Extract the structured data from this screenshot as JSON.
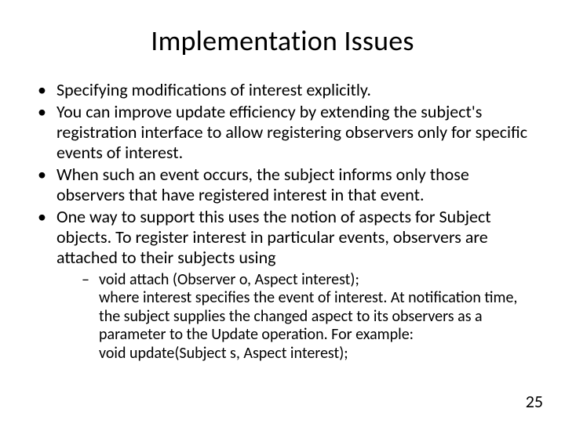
{
  "title": "Implementation Issues",
  "bullets": [
    {
      "text": "Specifying modifications of interest explicitly."
    },
    {
      "text": "You can improve update efficiency by extending the subject's registration interface to allow registering observers only for specific events of interest."
    },
    {
      "text": "When such an event occurs, the subject informs only those observers that have registered interest in that event."
    },
    {
      "text": "One way to support this uses the notion of aspects for Subject objects. To register interest in particular events, observers are attached to their subjects using"
    }
  ],
  "subbullet": {
    "line1": "void attach (Observer o, Aspect interest);",
    "line2": "where interest specifies the event of interest. At notification time, the subject supplies the changed aspect to its observers as a parameter to the Update operation. For example:",
    "line3": "void update(Subject s, Aspect interest);"
  },
  "pageNumber": "25"
}
